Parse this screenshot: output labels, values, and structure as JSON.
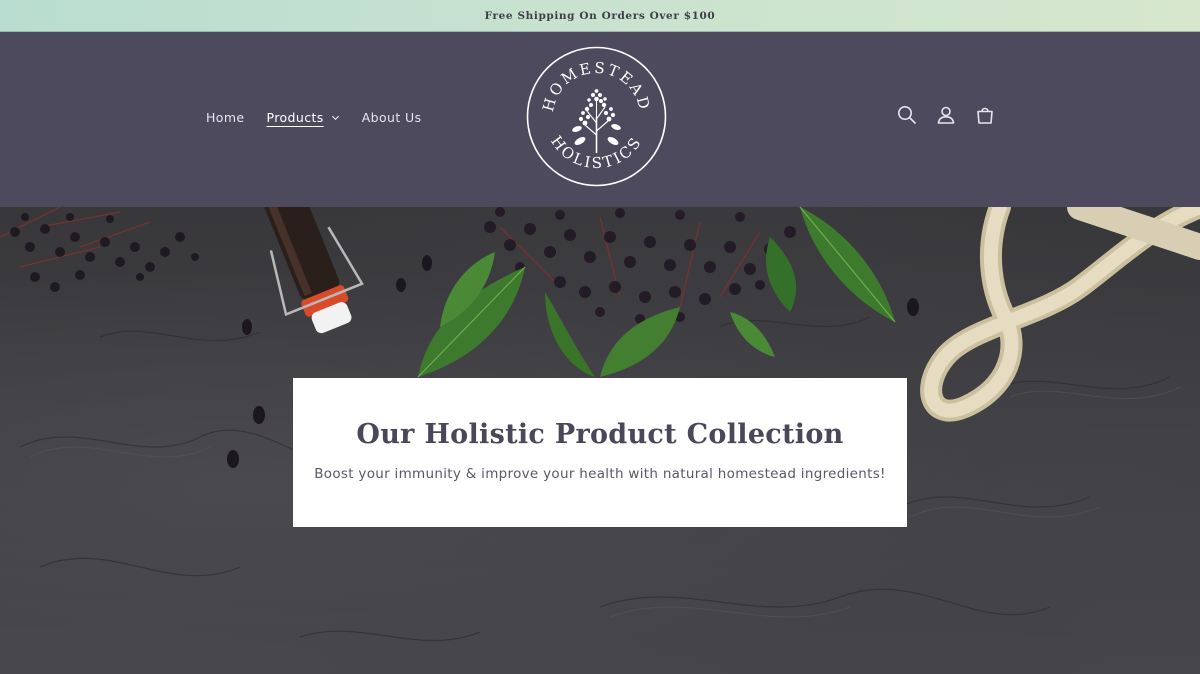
{
  "announcement": {
    "text": "Free Shipping On Orders Over $100"
  },
  "header": {
    "nav": [
      {
        "label": "Home",
        "active": false
      },
      {
        "label": "Products",
        "active": true,
        "has_dropdown": true
      },
      {
        "label": "About Us",
        "active": false
      }
    ],
    "logo": {
      "top_text": "HOMESTEAD",
      "bottom_text": "HOLISTICS",
      "icon": "elderberry-branch-icon"
    },
    "icons": [
      "search-icon",
      "account-icon",
      "cart-icon"
    ]
  },
  "hero": {
    "title": "Our Holistic Product Collection",
    "subtitle": "Boost your immunity & improve your health with natural homestead ingredients!"
  },
  "colors": {
    "header_bg": "#4e4a5e",
    "announcement_bg": "#c9e2cf",
    "card_bg": "#ffffff",
    "title_color": "#4a4758"
  }
}
